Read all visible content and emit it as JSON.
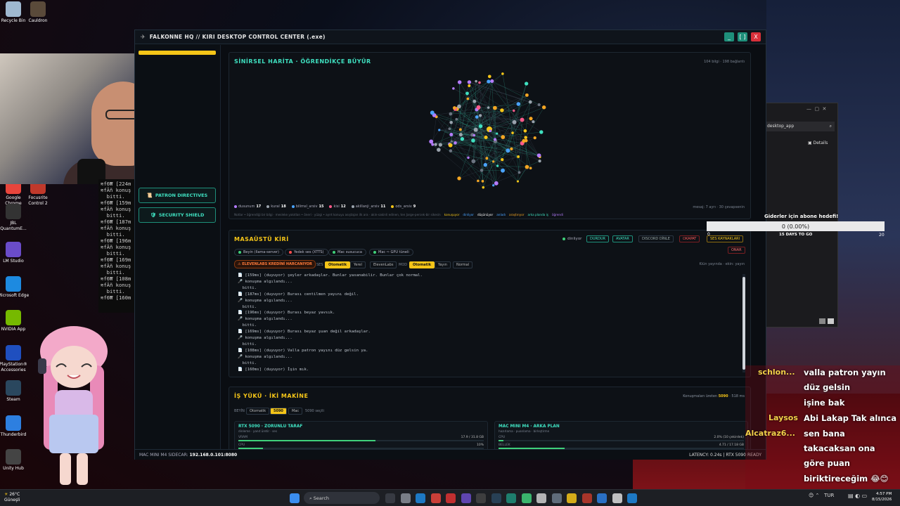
{
  "desktop": {
    "icons": [
      {
        "label": "Recycle Bin",
        "icon": "recycle-bin-icon",
        "color": "#9fb8d0"
      },
      {
        "label": "Cauldron",
        "icon": "cauldron-icon",
        "color": "#5a4a3a"
      },
      {
        "label": "Google Chrome",
        "icon": "chrome-icon",
        "color": "#e8453c"
      },
      {
        "label": "Focusrite Control 2",
        "icon": "focusrite-icon",
        "color": "#c0392b"
      },
      {
        "label": "JBL QuantumE...",
        "icon": "jbl-icon",
        "color": "#333"
      },
      {
        "label": "LM Studio",
        "icon": "lm-studio-icon",
        "color": "#6a4cc9"
      },
      {
        "label": "Microsoft Edge",
        "icon": "edge-icon",
        "color": "#1d8ae0"
      },
      {
        "label": "NVIDIA App",
        "icon": "nvidia-icon",
        "color": "#76b900"
      },
      {
        "label": "PlayStation® Accessories",
        "icon": "playstation-icon",
        "color": "#1f4fbf"
      },
      {
        "label": "Steam",
        "icon": "steam-icon",
        "color": "#2a475e"
      },
      {
        "label": "Thunderbird",
        "icon": "thunderbird-icon",
        "color": "#2d7fe0"
      },
      {
        "label": "Unity Hub",
        "icon": "unity-icon",
        "color": "#444"
      }
    ]
  },
  "terminal": {
    "lines": [
      "≋f6₩ [224m",
      "≋fÃñ konuş",
      "  bitti.",
      "≋f6₩ [159m",
      "≋fÃñ konuş",
      "  bitti.",
      "≋f6₩ [187m",
      "≋fÃñ konuş",
      "  bitti.",
      "≋f6₩ [196m",
      "≋fÃñ konuş",
      "  bitti.",
      "≋f6₩ [169m",
      "≋fÃñ konuş",
      "  bitti.",
      "≋f6₩ [108m",
      "≋fÃñ konuş",
      "  bitti.",
      "≋f6₩ [160m"
    ]
  },
  "window": {
    "title": "FALKONNE HQ // KIRI DESKTOP CONTROL CENTER (.exe)",
    "min_label": "_",
    "max_label": "[ ]",
    "close_label": "X"
  },
  "sidebar": {
    "buttons": [
      {
        "label": "PATRON DIRECTIVES",
        "icon": "scroll-icon"
      },
      {
        "label": "SECURITY SHIELD",
        "icon": "shield-icon"
      }
    ]
  },
  "neural_map": {
    "title": "SİNİRSEL HARİTA · ÖĞRENDİKÇE BÜYÜR",
    "counts": "104 bilgi · 198 bağlantı",
    "legend": [
      {
        "label": "dusunum",
        "count": "17",
        "color": "#b57cff"
      },
      {
        "label": "kural",
        "count": "18",
        "color": "#9aa3ad"
      },
      {
        "label": "bilimsl_arsiv",
        "count": "15",
        "color": "#4aa3ff"
      },
      {
        "label": "kisi",
        "count": "12",
        "color": "#ff5a8a"
      },
      {
        "label": "akillanji_arsiv",
        "count": "11",
        "color": "#9aa3ad"
      },
      {
        "label": "ods_arsiv",
        "count": "9",
        "color": "#f5c518"
      }
    ],
    "right_note": "mesaj: 7 ayrı · 30 çevapsenin",
    "footnote": "Notlar • öğrendiği bir bilgi · mesleke yakıtlan • öneri · yüzgi • ayrıt konuyu asıştajan ilk ara · akin-sakinli edinen, ten Jarge-percek-bir sikesin",
    "tags": [
      {
        "label": "konuşuyor",
        "color": "#f5c518"
      },
      {
        "label": "dinliyor",
        "color": "#4aa3ff"
      },
      {
        "label": "düşünüyor",
        "color": "#ffffff"
      },
      {
        "label": "anladı",
        "color": "#4aa3ff"
      },
      {
        "label": "araştırıyor",
        "color": "#f5a623"
      },
      {
        "label": "arka planda iş",
        "color": "#3fe0c0"
      },
      {
        "label": "öğrendi",
        "color": "#b57cff"
      }
    ]
  },
  "desktop_kiri": {
    "title": "MASAÜSTÜ KİRİ",
    "status": "dinliyor",
    "buttons": [
      "DURDUR",
      "AVATAR",
      "DISCORD DİNLE",
      "KAPAT",
      "SES KAYNAKLARI",
      "ONAR"
    ],
    "status_chips": [
      {
        "label": "Beyin (llama-server)",
        "color": "#3fd07a"
      },
      {
        "label": "Yedek ses (XTTS)",
        "color": "#ff4d4d"
      },
      {
        "label": "Mac susucuca",
        "color": "#3fd07a"
      },
      {
        "label": "Mac ⇨ GPU tüneli",
        "color": "#3fd07a"
      }
    ],
    "warning": "⚠ ELEVENLABS KREDİNİ HARCANIYOR",
    "ses_label": "SES",
    "ses_options": [
      "Otomatik",
      "Yerel",
      "ElevenLabs"
    ],
    "mod_label": "MOD",
    "mod_options": [
      "Otomatik",
      "Yayın",
      "Normal"
    ],
    "right_hint": "Kiün yayında · ekin: yayın",
    "log": [
      "📄 [159ms] (duyuyor) şeyler arkadaşlar. Bunlar yasanabilir. Bunlar çok normal.",
      "🎤 konuşma algılandı...",
      "  bitti.",
      "📄 [187ms] (duyuyor) Burası centilmen yayını değil.",
      "🎤 konuşma algılandı...",
      "  bitti.",
      "📄 [196ms] (duyuyor) Burası beyaz yavsık.",
      "🎤 konuşma algılandı...",
      "  bitti.",
      "📄 [169ms] (duyuyor) Burası beyaz şuan değil arkadaşlar.",
      "🎤 konuşma algılandı...",
      "  bitti.",
      "📄 [108ms] (duyuyor) Valla patron yayını düz gelsin ya.",
      "🎤 konuşma algılandı...",
      "  bitti.",
      "📄 [160ms] (duyuyor) İşin mık."
    ]
  },
  "workload": {
    "title": "İŞ YÜKÜ · İKİ MAKİNE",
    "right": "Konuşmaları üreten",
    "right_gpu": "5090",
    "right_ms": "· 518 ms",
    "beyin_label": "BEYİN",
    "beyin_options": [
      "Otomatik",
      "5090",
      "Mac"
    ],
    "beyin_selected": "5090 seçili",
    "machines": [
      {
        "title": "RTX 5090 · ZORUNLU TARAF",
        "sub": "dinleme · yanıt üretir · ses",
        "rows": [
          {
            "label": "VRAM",
            "value": "17.9 / 31.8 GB",
            "fill": 0.56
          },
          {
            "label": "CPU",
            "value": "10%",
            "fill": 0.1
          }
        ]
      },
      {
        "title": "MAC MINI M4 · ARKA PLAN",
        "sub": "hazırlama · puanlama · birleştirme",
        "rows": [
          {
            "label": "CPU",
            "value": "2.0% (10 çekirdek)",
            "fill": 0.02
          },
          {
            "label": "BELLEK",
            "value": "4.71 / 17.18 GB",
            "fill": 0.27
          }
        ]
      }
    ]
  },
  "statusbar": {
    "left_label": "MAC MINI M4 SIDECAR:",
    "left_value": "192.168.0.101:8080",
    "right": "LATENCY: 0.24s | RTX 5090 READY"
  },
  "explorer": {
    "path": "desktop_app",
    "details": "Details"
  },
  "goal": {
    "title": "Giderler için abone hedefi!",
    "value": "0 (0.00%)",
    "left": "0",
    "days": "15 DAYS TO GO",
    "right": "20"
  },
  "chat": {
    "messages": [
      {
        "name": "schlon...",
        "text": "valla patron yayın"
      },
      {
        "name": "",
        "text": "düz gelsin"
      },
      {
        "name": "",
        "text": "işine bak"
      },
      {
        "name": "Laysos",
        "text": "Abi Lakap Tak alınca"
      },
      {
        "name": "Alcatraz6...",
        "text": "sen bana"
      },
      {
        "name": "",
        "text": "takacaksan ona"
      },
      {
        "name": "",
        "text": "göre puan"
      },
      {
        "name": "",
        "text": "biriktireceğim 😂😊"
      }
    ]
  },
  "taskbar": {
    "weather_temp": "26°C",
    "weather_desc": "Güneşli",
    "search_placeholder": "Search",
    "lang": "TUR",
    "time": "4:57 PM",
    "date": "8/15/2026"
  }
}
